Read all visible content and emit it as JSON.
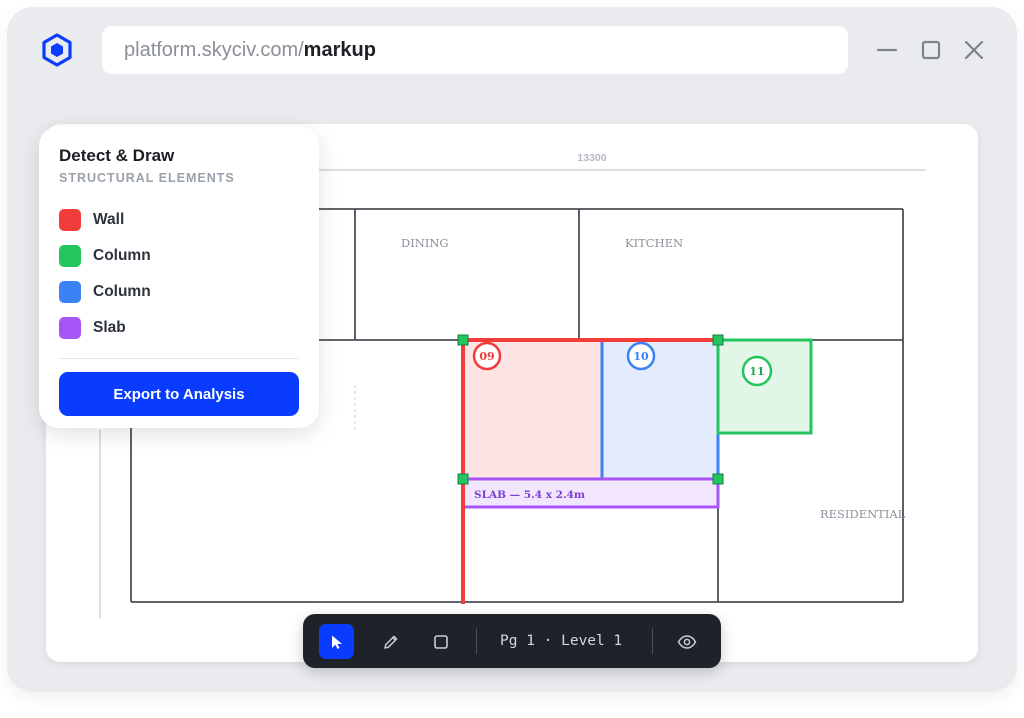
{
  "browser": {
    "url_domain": "platform.skyciv.com/",
    "url_path": "markup"
  },
  "panel": {
    "title": "Detect & Draw",
    "subtitle": "STRUCTURAL ELEMENTS",
    "legend": [
      {
        "label": "Wall",
        "color": "#f23c3c"
      },
      {
        "label": "Column",
        "color": "#22c55e"
      },
      {
        "label": "Column",
        "color": "#3b82f6"
      },
      {
        "label": "Slab",
        "color": "#a855f7"
      }
    ],
    "export_label": "Export to Analysis"
  },
  "plan": {
    "dimension": "13300",
    "rooms": {
      "dining": "DINING",
      "kitchen": "KITCHEN",
      "residential": "RESIDENTIAL"
    },
    "markers": {
      "wall": "09",
      "column_blue": "10",
      "column_green": "11"
    },
    "slab_label": "SLAB — 5.4 x 2.4m"
  },
  "toolbar": {
    "page_label": "Pg 1 · Level 1"
  },
  "colors": {
    "accent": "#0a3cff",
    "wall": "#f23c3c",
    "column_green": "#22c55e",
    "column_blue": "#3b82f6",
    "slab": "#a855f7"
  }
}
